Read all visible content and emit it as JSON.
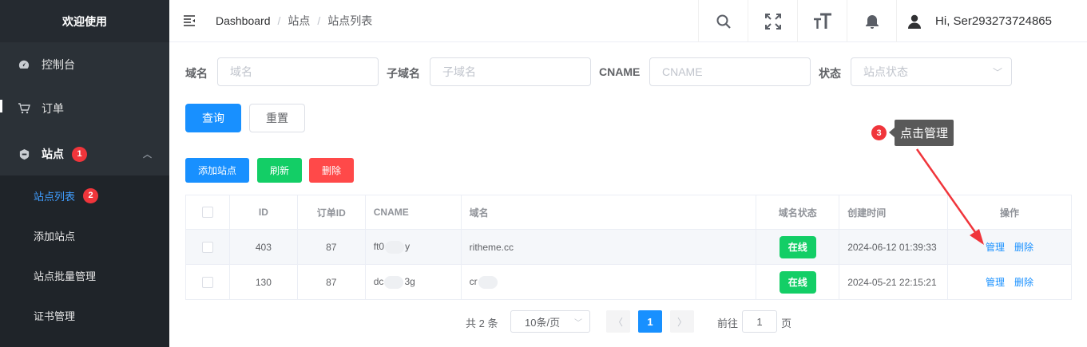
{
  "sidebar": {
    "title": "欢迎使用",
    "items": [
      {
        "label": "控制台",
        "icon": "dashboard-icon"
      },
      {
        "label": "订单",
        "icon": "cart-icon"
      },
      {
        "label": "站点",
        "icon": "site-icon",
        "badge": "1"
      }
    ],
    "subitems": [
      {
        "label": "站点列表",
        "badge": "2",
        "active": true
      },
      {
        "label": "添加站点"
      },
      {
        "label": "站点批量管理"
      },
      {
        "label": "证书管理"
      }
    ]
  },
  "header": {
    "breadcrumb": [
      "Dashboard",
      "站点",
      "站点列表"
    ],
    "separator": "/",
    "user_greeting": "Hi, Ser293273724865",
    "icons": [
      "search-icon",
      "fullscreen-icon",
      "font-size-icon",
      "bell-icon",
      "user-icon"
    ]
  },
  "filters": {
    "domain_label": "域名",
    "domain_placeholder": "域名",
    "subdomain_label": "子域名",
    "subdomain_placeholder": "子域名",
    "cname_label": "CNAME",
    "cname_placeholder": "CNAME",
    "status_label": "状态",
    "status_placeholder": "站点状态",
    "search_button": "查询",
    "reset_button": "重置"
  },
  "actions": {
    "add": "添加站点",
    "refresh": "刷新",
    "delete": "删除"
  },
  "table": {
    "columns": [
      "ID",
      "订单ID",
      "CNAME",
      "域名",
      "域名状态",
      "创建时间",
      "操作"
    ],
    "rows": [
      {
        "id": "403",
        "order_id": "87",
        "cname_start": "ft0",
        "cname_end": "y",
        "domain": "ritheme.cc",
        "status": "在线",
        "created": "2024-06-12 01:39:33",
        "manage": "管理",
        "delete": "删除"
      },
      {
        "id": "130",
        "order_id": "87",
        "cname_start": "dc",
        "cname_end": "3g",
        "domain": "cr",
        "status": "在线",
        "created": "2024-05-21 22:15:21",
        "manage": "管理",
        "delete": "删除"
      }
    ]
  },
  "pagination": {
    "total": "共 2 条",
    "page_size": "10条/页",
    "current_page": "1",
    "goto_label": "前往",
    "goto_value": "1",
    "page_suffix": "页"
  },
  "annotation": {
    "step": "3",
    "text": "点击管理",
    "color": "#f0353b"
  },
  "colors": {
    "primary": "#1890ff",
    "success": "#13ce66",
    "danger": "#ff4949",
    "sidebar_bg": "#2b3137"
  }
}
